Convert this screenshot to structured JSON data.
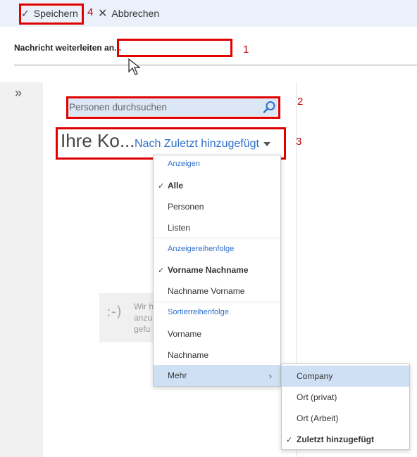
{
  "toolbar": {
    "save_label": "Speichern",
    "cancel_label": "Abbrechen"
  },
  "forward": {
    "label": "Nachricht weiterleiten an...",
    "value": ""
  },
  "search": {
    "placeholder": "Personen durchsuchen"
  },
  "contacts": {
    "title": "Ihre Ko...",
    "sort_label": "Nach Zuletzt hinzugefügt",
    "empty_text_lines": [
      "Wir h",
      "anzu",
      "gefu"
    ]
  },
  "menu": {
    "header_show": "Anzeigen",
    "show_items": [
      "Alle",
      "Personen",
      "Listen"
    ],
    "header_order": "Anzeigereihenfolge",
    "order_items": [
      "Vorname Nachname",
      "Nachname Vorname"
    ],
    "header_sort": "Sortierreihenfolge",
    "sort_items": [
      "Vorname",
      "Nachname"
    ],
    "more_label": "Mehr"
  },
  "submenu": {
    "items": [
      "Company",
      "Ort (privat)",
      "Ort (Arbeit)",
      "Zuletzt hinzugefügt"
    ]
  },
  "callouts": [
    "1",
    "2",
    "3",
    "4"
  ],
  "colors": {
    "accent": "#2f6fc8",
    "highlight": "#cfe0f5",
    "callout": "#e00000",
    "toolbar_bg": "#eaf1fb"
  }
}
